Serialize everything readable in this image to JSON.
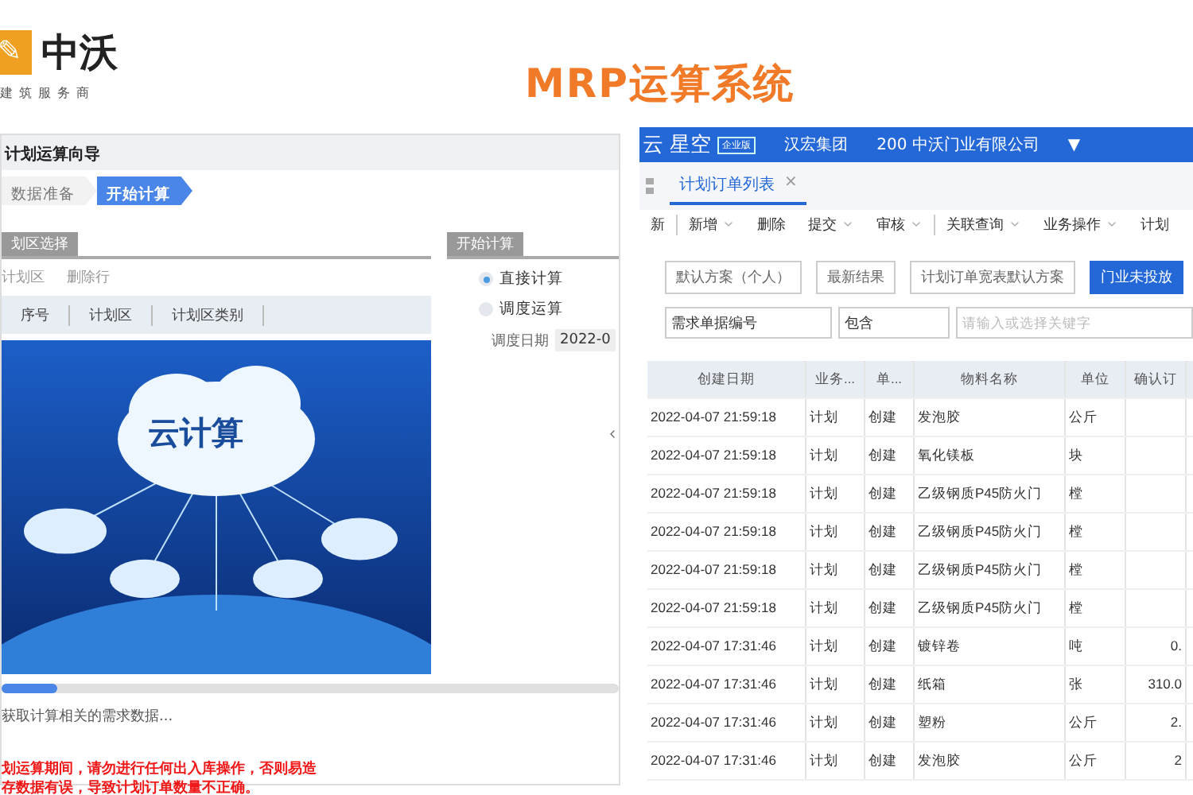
{
  "header": {
    "logo_mark": "✎",
    "logo_name": "中沃",
    "logo_tagline": "建筑服务商",
    "title": "MRP运算系统"
  },
  "wizard": {
    "title": "计划运算向导",
    "steps": [
      {
        "label": "数据准备",
        "selected": false
      },
      {
        "label": "开始计算",
        "selected": true
      }
    ],
    "section_title": "划区选择",
    "actions": [
      "计划区",
      "删除行"
    ],
    "columns": [
      "序号",
      "计划区",
      "计划区类别"
    ],
    "image_label": "云计算",
    "progress": {
      "level": 0.09
    },
    "status": "获取计算相关的需求数据...",
    "warning": [
      "划运算期间，请勿进行任何出入库操作，否则易造",
      "存数据有误，导致计划订单数量不正确。"
    ]
  },
  "calc": {
    "title": "开始计算",
    "options": [
      {
        "label": "直接计算",
        "selected": true
      },
      {
        "label": "调度运算",
        "selected": false
      }
    ],
    "date_label": "调度日期",
    "date_value": "2022-0"
  },
  "erp": {
    "brand": "云 星空",
    "edition": "企业版",
    "group": "汉宏集团",
    "company": "200  中沃门业有限公司",
    "company_caret": "▼",
    "tab": {
      "label": "计划订单列表",
      "close": "×"
    },
    "toolbar": [
      {
        "label": "新",
        "dropdown": false,
        "separator_after": true
      },
      {
        "label": "新增",
        "dropdown": true,
        "separator_after": false
      },
      {
        "label": "删除",
        "dropdown": false,
        "separator_after": false
      },
      {
        "label": "提交",
        "dropdown": true,
        "separator_after": false
      },
      {
        "label": "审核",
        "dropdown": true,
        "separator_after": true
      },
      {
        "label": "关联查询",
        "dropdown": true,
        "separator_after": false
      },
      {
        "label": "业务操作",
        "dropdown": true,
        "separator_after": false
      },
      {
        "label": "计划",
        "dropdown": false,
        "separator_after": false
      }
    ],
    "schemes": [
      {
        "label": "默认方案（个人）",
        "selected": false
      },
      {
        "label": "最新结果",
        "selected": false
      },
      {
        "label": "计划订单宽表默认方案",
        "selected": false
      },
      {
        "label": "门业未投放",
        "selected": true
      }
    ],
    "filter": {
      "field": "需求单据编号",
      "operator": "包含",
      "placeholder": "请输入或选择关键字"
    },
    "table": {
      "columns": [
        "创建日期",
        "业务...",
        "单...",
        "物料名称",
        "单位",
        "确认订"
      ],
      "rows": [
        [
          "2022-04-07 21:59:18",
          "计划",
          "创建",
          "发泡胶",
          "公斤"
        ],
        [
          "2022-04-07 21:59:18",
          "计划",
          "创建",
          "氧化镁板",
          "块"
        ],
        [
          "2022-04-07 21:59:18",
          "计划",
          "创建",
          "乙级钢质P45防火门",
          "樘"
        ],
        [
          "2022-04-07 21:59:18",
          "计划",
          "创建",
          "乙级钢质P45防火门",
          "樘"
        ],
        [
          "2022-04-07 21:59:18",
          "计划",
          "创建",
          "乙级钢质P45防火门",
          "樘"
        ],
        [
          "2022-04-07 21:59:18",
          "计划",
          "创建",
          "乙级钢质P45防火门",
          "樘"
        ],
        [
          "2022-04-07 17:31:46",
          "计划",
          "创建",
          "镀锌卷",
          "吨",
          "0."
        ],
        [
          "2022-04-07 17:31:46",
          "计划",
          "创建",
          "纸箱",
          "张",
          "310.0"
        ],
        [
          "2022-04-07 17:31:46",
          "计划",
          "创建",
          "塑粉",
          "公斤",
          "2."
        ],
        [
          "2022-04-07 17:31:46",
          "计划",
          "创建",
          "发泡胶",
          "公斤",
          "2"
        ]
      ]
    }
  }
}
